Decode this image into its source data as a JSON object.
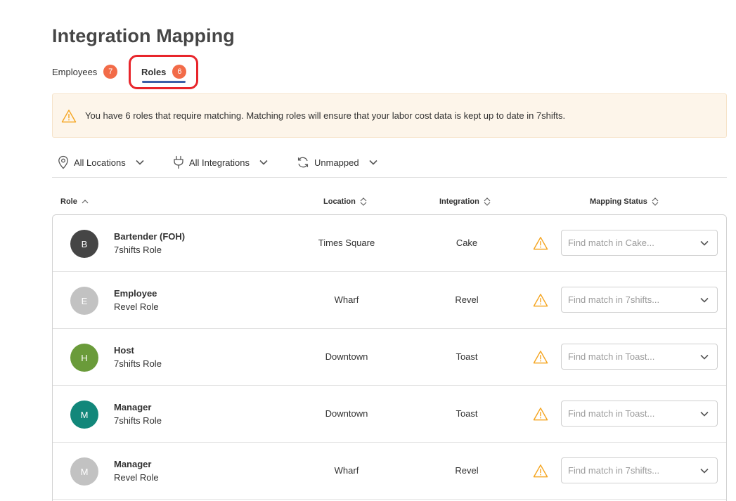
{
  "page": {
    "title": "Integration Mapping"
  },
  "tabs": [
    {
      "label": "Employees",
      "count": "7"
    },
    {
      "label": "Roles",
      "count": "6"
    }
  ],
  "alert": {
    "icon": "warning-icon",
    "message": "You have 6 roles that require matching. Matching roles will ensure that your labor cost data is kept up to date in 7shifts."
  },
  "filters": {
    "location": {
      "label": "All Locations",
      "icon": "location-pin-icon"
    },
    "integration": {
      "label": "All Integrations",
      "icon": "plug-icon"
    },
    "mapping": {
      "label": "Unmapped",
      "icon": "sync-icon"
    }
  },
  "table": {
    "headers": {
      "role": "Role",
      "location": "Location",
      "integration": "Integration",
      "status": "Mapping Status"
    },
    "rows": [
      {
        "initial": "B",
        "avatar_color": "#454545",
        "name": "Bartender (FOH)",
        "source": "7shifts Role",
        "location": "Times Square",
        "integration": "Cake",
        "placeholder": "Find match in Cake..."
      },
      {
        "initial": "E",
        "avatar_color": "#c2c2c2",
        "name": "Employee",
        "source": "Revel Role",
        "location": "Wharf",
        "integration": "Revel",
        "placeholder": "Find match in 7shifts..."
      },
      {
        "initial": "H",
        "avatar_color": "#6a9b3a",
        "name": "Host",
        "source": "7shifts Role",
        "location": "Downtown",
        "integration": "Toast",
        "placeholder": "Find match in Toast..."
      },
      {
        "initial": "M",
        "avatar_color": "#12877a",
        "name": "Manager",
        "source": "7shifts Role",
        "location": "Downtown",
        "integration": "Toast",
        "placeholder": "Find match in Toast..."
      },
      {
        "initial": "M",
        "avatar_color": "#c2c2c2",
        "name": "Manager",
        "source": "Revel Role",
        "location": "Wharf",
        "integration": "Revel",
        "placeholder": "Find match in 7shifts..."
      }
    ]
  },
  "colors": {
    "badge": "#f26b48",
    "tab_underline": "#3b5fa8",
    "highlight_ring": "#e8252b",
    "warning": "#f5a623",
    "alert_bg": "#fdf5ea"
  }
}
